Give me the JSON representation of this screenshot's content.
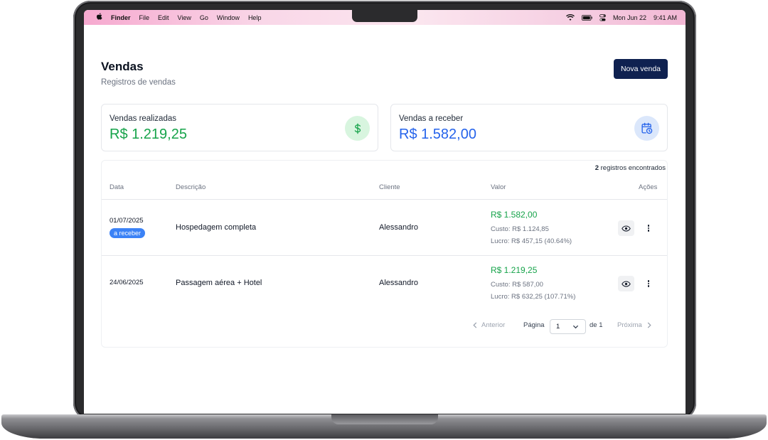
{
  "menubar": {
    "apple_icon": "apple-logo-icon",
    "app_name": "Finder",
    "menus": [
      "File",
      "Edit",
      "View",
      "Go",
      "Window",
      "Help"
    ],
    "date": "Mon Jun 22",
    "time": "9:41 AM"
  },
  "page": {
    "title": "Vendas",
    "subtitle": "Registros de vendas",
    "new_button": "Nova venda"
  },
  "summary": {
    "realizadas": {
      "label": "Vendas realizadas",
      "value": "R$ 1.219,25",
      "icon": "dollar-icon"
    },
    "a_receber": {
      "label": "Vendas a receber",
      "value": "R$ 1.582,00",
      "icon": "calendar-clock-icon"
    }
  },
  "table": {
    "count_number": "2",
    "count_text": " registros encontrados",
    "headers": {
      "data": "Data",
      "descricao": "Descrição",
      "cliente": "Cliente",
      "valor": "Valor",
      "acoes": "Ações"
    },
    "rows": [
      {
        "date": "01/07/2025",
        "badge": "a receber",
        "description": "Hospedagem completa",
        "client": "Alessandro",
        "value": "R$ 1.582,00",
        "cost": "Custo: R$ 1.124,85",
        "profit": "Lucro: R$ 457,15 (40.64%)"
      },
      {
        "date": "24/06/2025",
        "description": "Passagem aérea + Hotel",
        "client": "Alessandro",
        "value": "R$ 1.219,25",
        "cost": "Custo: R$ 587,00",
        "profit": "Lucro: R$ 632,25 (107.71%)"
      }
    ]
  },
  "pagination": {
    "prev": "Anterior",
    "page_label": "Página",
    "current": "1",
    "of_label": "de 1",
    "next": "Próxima"
  },
  "colors": {
    "accent_navy": "#0f2150",
    "positive_green": "#16a34a",
    "receivable_blue": "#2563eb",
    "badge_blue": "#3b82f6"
  }
}
